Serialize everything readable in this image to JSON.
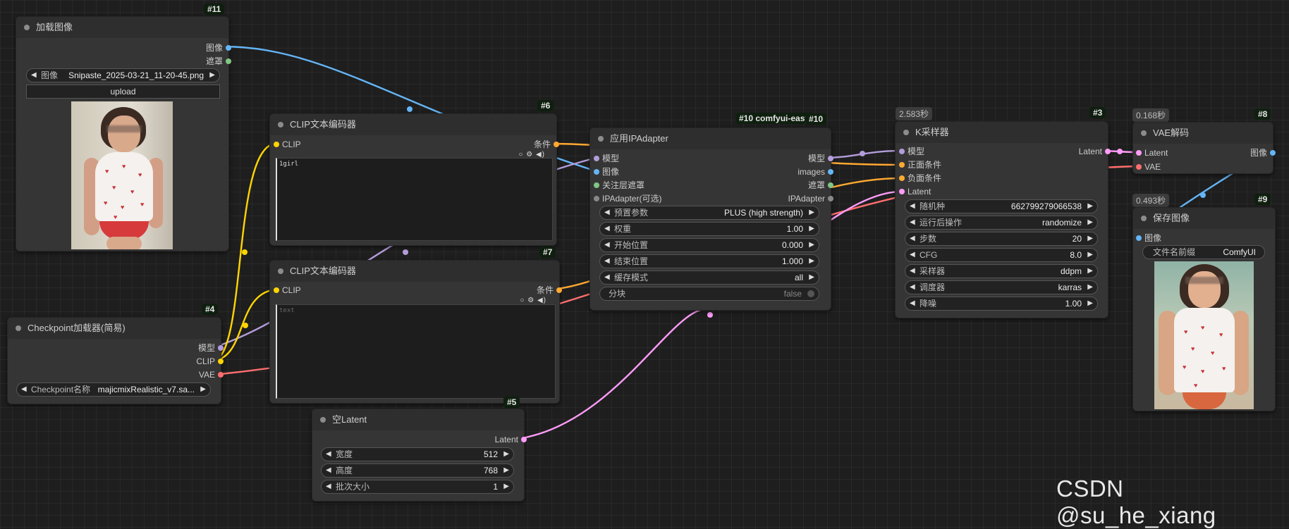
{
  "load_image": {
    "badge": "#11",
    "title": "加载图像",
    "out_image": "图像",
    "out_mask": "遮罩",
    "image_label": "图像",
    "image_value": "Snipaste_2025-03-21_11-20-45.png",
    "upload": "upload"
  },
  "clip6": {
    "badge": "#6",
    "title": "CLIP文本编码器",
    "in_clip": "CLIP",
    "out_cond": "条件",
    "text": "1girl"
  },
  "clip7": {
    "badge": "#7",
    "title": "CLIP文本编码器",
    "in_clip": "CLIP",
    "out_cond": "条件",
    "placeholder": "text"
  },
  "checkpoint": {
    "badge": "#4",
    "title": "Checkpoint加载器(简易)",
    "out_model": "模型",
    "out_clip": "CLIP",
    "out_vae": "VAE",
    "ckpt_label": "Checkpoint名称",
    "ckpt_value": "majicmixRealistic_v7.sa..."
  },
  "empty_latent": {
    "badge": "#5",
    "title": "空Latent",
    "out_latent": "Latent",
    "width_label": "宽度",
    "width_value": "512",
    "height_label": "高度",
    "height_value": "768",
    "batch_label": "批次大小",
    "batch_value": "1"
  },
  "ipadapter": {
    "badge_group": "#10 comfyui-easy",
    "badge": "#10",
    "title": "应用IPAdapter",
    "in_model": "模型",
    "in_image": "图像",
    "in_attn_mask": "关注层遮罩",
    "in_ipadapter": "IPAdapter(可选)",
    "out_model": "模型",
    "out_images": "images",
    "out_mask": "遮罩",
    "out_ipadapter": "IPAdapter",
    "preset_label": "预置参数",
    "preset_value": "PLUS (high strength)",
    "weight_label": "权重",
    "weight_value": "1.00",
    "start_label": "开始位置",
    "start_value": "0.000",
    "end_label": "结束位置",
    "end_value": "1.000",
    "cache_label": "缓存模式",
    "cache_value": "all",
    "tile_label": "分块",
    "tile_value": "false"
  },
  "ksampler": {
    "badge": "#3",
    "time": "2.583秒",
    "title": "K采样器",
    "in_model": "模型",
    "in_pos": "正面条件",
    "in_neg": "负面条件",
    "in_latent": "Latent",
    "out_latent": "Latent",
    "seed_label": "随机种",
    "seed_value": "662799279066538",
    "after_label": "运行后操作",
    "after_value": "randomize",
    "steps_label": "步数",
    "steps_value": "20",
    "cfg_label": "CFG",
    "cfg_value": "8.0",
    "sampler_label": "采样器",
    "sampler_value": "ddpm",
    "scheduler_label": "调度器",
    "scheduler_value": "karras",
    "denoise_label": "降噪",
    "denoise_value": "1.00"
  },
  "vae_decode": {
    "badge": "#8",
    "time": "0.168秒",
    "title": "VAE解码",
    "in_latent": "Latent",
    "in_vae": "VAE",
    "out_image": "图像"
  },
  "save_image": {
    "badge": "#9",
    "time": "0.493秒",
    "title": "保存图像",
    "in_image": "图像",
    "prefix_label": "文件名前缀",
    "prefix_value": "ComfyUI"
  },
  "watermark": "CSDN @su_he_xiang",
  "colors": {
    "image": "#64b5f6",
    "mask": "#81c784",
    "model": "#b39ddb",
    "clip": "#ffd500",
    "vae": "#ff6e6e",
    "conditioning": "#ffa931",
    "latent": "#ff9cf9",
    "ipadapter": "#888888"
  }
}
